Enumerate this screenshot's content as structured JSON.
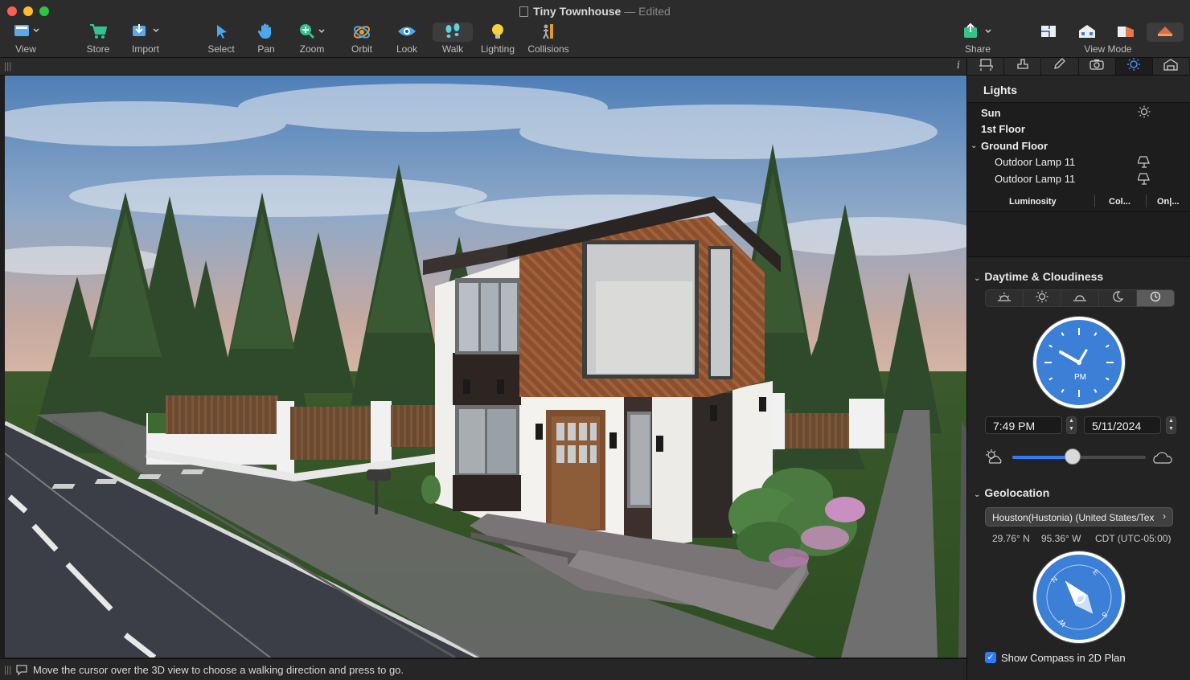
{
  "window": {
    "title": "Tiny Townhouse",
    "separator": "—",
    "status": "Edited"
  },
  "toolbar": {
    "view": "View",
    "store": "Store",
    "import": "Import",
    "select": "Select",
    "pan": "Pan",
    "zoom": "Zoom",
    "orbit": "Orbit",
    "look": "Look",
    "walk": "Walk",
    "lighting": "Lighting",
    "collisions": "Collisions",
    "share": "Share",
    "view_mode": "View Mode"
  },
  "statusbar": {
    "message": "Move the cursor over the 3D view to choose a walking direction and press to go."
  },
  "panel": {
    "lights": {
      "header": "Lights",
      "items": [
        {
          "label": "Sun",
          "icon": "sun-icon"
        },
        {
          "label": "1st Floor",
          "icon": ""
        },
        {
          "label": "Ground Floor",
          "icon": ""
        },
        {
          "label": "Outdoor Lamp 11",
          "icon": "lamp-icon"
        },
        {
          "label": "Outdoor Lamp 11",
          "icon": "lamp-icon"
        }
      ],
      "columns": [
        "Luminosity",
        "Col...",
        "On|..."
      ]
    },
    "daytime": {
      "title": "Daytime & Cloudiness",
      "modes": [
        "sunrise-icon",
        "sun-icon",
        "sunset-icon",
        "moon-icon",
        "clock-icon"
      ],
      "selected_mode": "clock-icon",
      "clock_label": "PM",
      "time": "7:49 PM",
      "date": "5/11/2024",
      "cloudiness": 0.45
    },
    "geolocation": {
      "title": "Geolocation",
      "location": "Houston(Hustonia) (United States/Tex",
      "lat": "29.76° N",
      "lon": "95.36° W",
      "tz": "CDT (UTC-05:00)",
      "compass_letters": {
        "n": "N",
        "e": "E",
        "s": "S",
        "w": "W"
      },
      "show_compass_label": "Show Compass in 2D Plan",
      "show_compass_checked": true
    }
  },
  "colors": {
    "accent": "#2f7cf6",
    "dial": "#3b80d6",
    "toolbar_icon": "#38b6e8"
  }
}
